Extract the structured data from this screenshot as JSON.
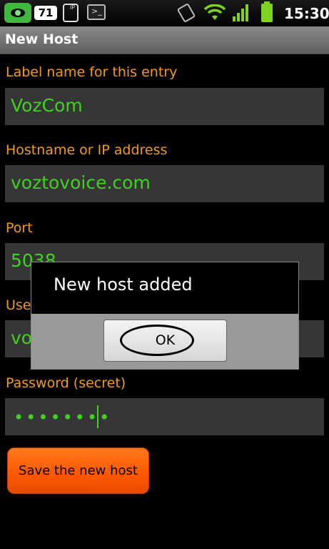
{
  "status_bar": {
    "notification_count": "71",
    "clock": "15:30",
    "phone_badge": "IP",
    "terminal_glyph": ">_",
    "icons": [
      "eye-app-icon",
      "notification-badge-icon",
      "sip-phone-icon",
      "terminal-icon",
      "vibrate-icon",
      "wifi-icon",
      "signal-icon",
      "battery-icon"
    ],
    "accent_color": "#7ed321"
  },
  "title_bar": {
    "title": "New Host"
  },
  "form": {
    "label_name": {
      "label": "Label name for this entry",
      "value": "VozCom"
    },
    "hostname": {
      "label": "Hostname or IP address",
      "value": "voztovoice.com"
    },
    "port": {
      "label": "Port",
      "value": "5038"
    },
    "username": {
      "label": "User name",
      "value": "vo"
    },
    "password": {
      "label": "Password (secret)",
      "value": "••••••••"
    },
    "save_button": "Save the new host",
    "label_color": "#f29a1c",
    "value_color": "#3fd21e"
  },
  "dialog": {
    "message": "New host added",
    "ok_button": "OK"
  }
}
